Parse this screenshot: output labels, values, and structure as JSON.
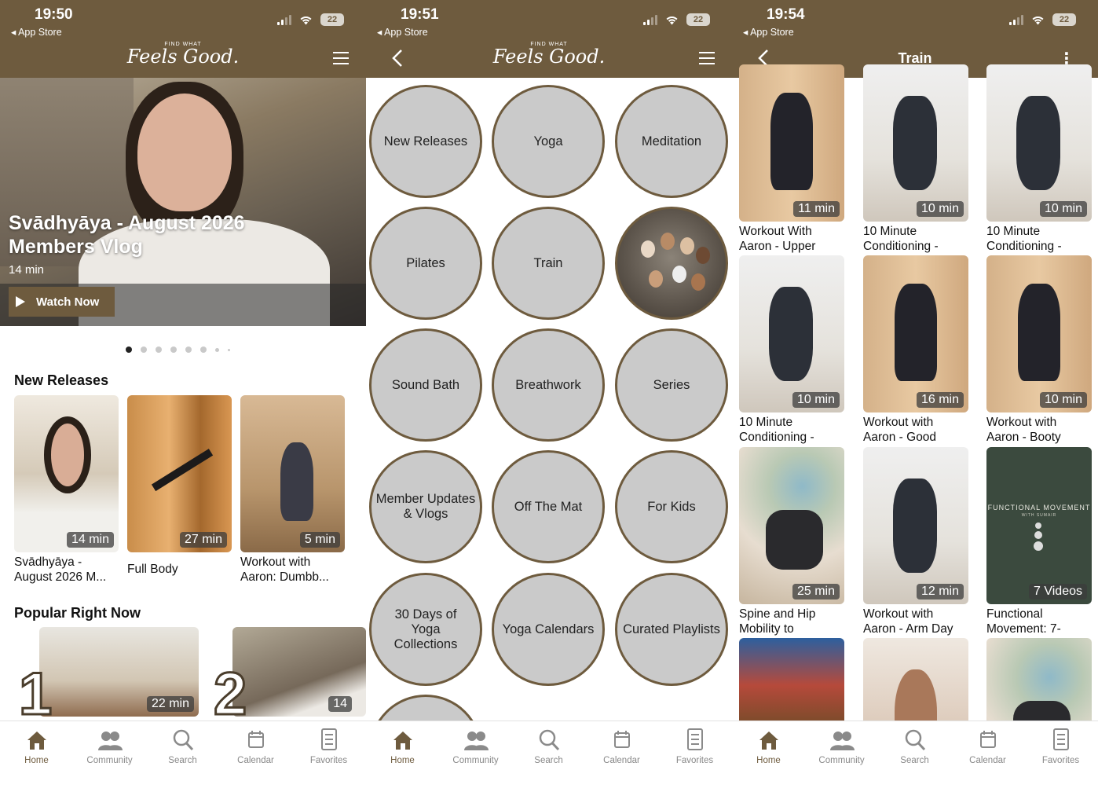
{
  "status": {
    "screens": [
      {
        "time": "19:50",
        "back_app": "App Store",
        "battery": "22"
      },
      {
        "time": "19:51",
        "back_app": "App Store",
        "battery": "22"
      },
      {
        "time": "19:54",
        "back_app": "App Store",
        "battery": "22"
      }
    ]
  },
  "brand": {
    "tagline": "FIND WHAT",
    "name": "Feels Good.",
    "color": "#6e5b3e"
  },
  "home": {
    "hero": {
      "title": "Svādhyāya - August 2026 Members Vlog",
      "duration": "14 min",
      "cta": "Watch Now"
    },
    "carousel": {
      "count": 8,
      "active_index": 0
    },
    "new_releases": {
      "heading": "New Releases",
      "items": [
        {
          "duration": "14 min",
          "title_line1": "Svādhyāya -",
          "title_line2": "August 2026 M..."
        },
        {
          "duration": "27 min",
          "title_line1": "Full Body",
          "title_line2": ""
        },
        {
          "duration": "5 min",
          "title_line1": "Workout with",
          "title_line2": "Aaron: Dumbb..."
        }
      ]
    },
    "popular": {
      "heading": "Popular Right Now",
      "items": [
        {
          "rank": "1",
          "duration": "22 min"
        },
        {
          "rank": "2",
          "duration": "14"
        }
      ]
    }
  },
  "categories": {
    "items": [
      "New Releases",
      "Yoga",
      "Meditation",
      "Pilates",
      "Train",
      "",
      "Sound Bath",
      "Breathwork",
      "Series",
      "Member Updates & Vlogs",
      "Off The Mat",
      "For Kids",
      "30 Days of Yoga Collections",
      "Yoga Calendars",
      "Curated Playlists"
    ]
  },
  "train": {
    "title": "Train",
    "videos": [
      {
        "duration": "11 min",
        "line1": "Workout With",
        "line2": "Aaron - Upper"
      },
      {
        "duration": "10 min",
        "line1": "10 Minute",
        "line2": "Conditioning -"
      },
      {
        "duration": "10 min",
        "line1": "10 Minute",
        "line2": "Conditioning -"
      },
      {
        "duration": "10 min",
        "line1": "10 Minute",
        "line2": "Conditioning -"
      },
      {
        "duration": "16 min",
        "line1": "Workout with",
        "line2": "Aaron - Good"
      },
      {
        "duration": "10 min",
        "line1": "Workout with",
        "line2": "Aaron - Booty"
      },
      {
        "duration": "25 min",
        "line1": "Spine and Hip",
        "line2": "Mobility to"
      },
      {
        "duration": "12 min",
        "line1": "Workout with",
        "line2": "Aaron - Arm Day"
      },
      {
        "duration": "7 Videos",
        "line1": "Functional",
        "line2": "Movement: 7-"
      }
    ],
    "series_card": {
      "title": "FUNCTIONAL MOVEMENT",
      "subtitle": "WITH SUMAIR"
    }
  },
  "tabbar": {
    "home": "Home",
    "community": "Community",
    "search": "Search",
    "calendar": "Calendar",
    "favorites": "Favorites"
  }
}
